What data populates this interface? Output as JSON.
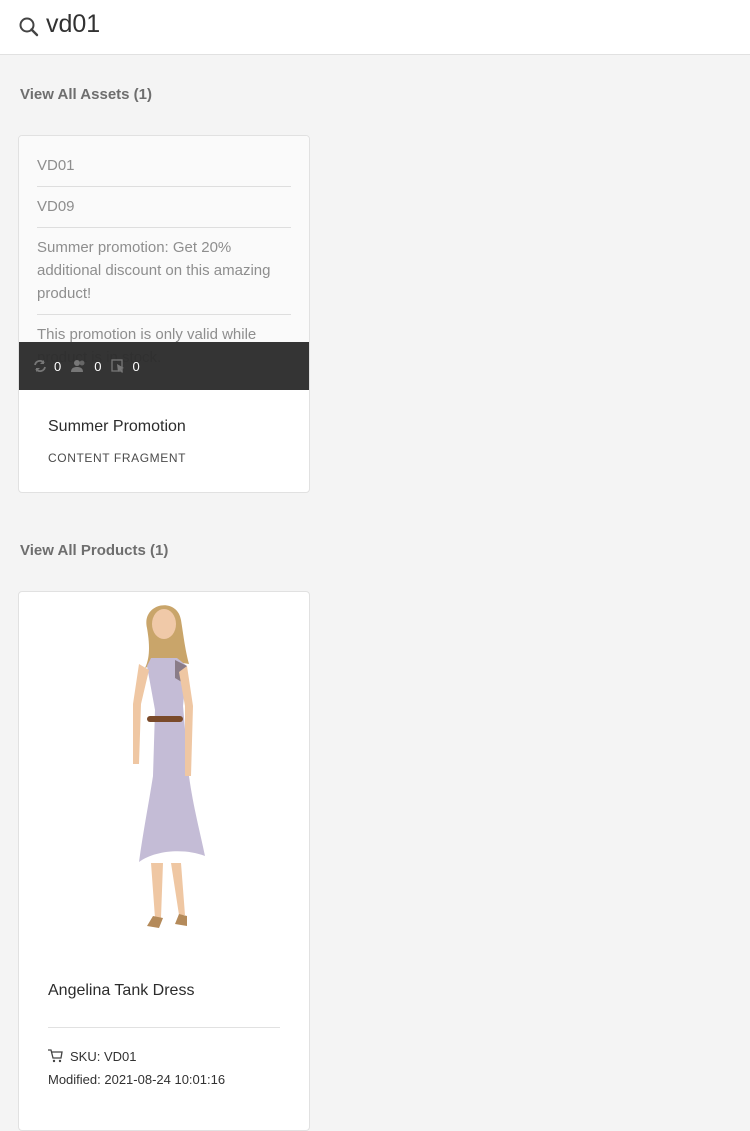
{
  "search": {
    "value": "vd01",
    "icon": "search-icon"
  },
  "assets": {
    "heading": "View All Assets (1)",
    "card": {
      "preview_rows": [
        "VD01",
        "VD09",
        "Summer promotion: Get 20% additional discount on this amazing product!",
        "This promotion is only valid while product is in stock."
      ],
      "stats": [
        {
          "icon": "sync-icon",
          "value": "0"
        },
        {
          "icon": "users-icon",
          "value": "0"
        },
        {
          "icon": "cursor-icon",
          "value": "0"
        }
      ],
      "title": "Summer Promotion",
      "type": "CONTENT FRAGMENT"
    }
  },
  "products": {
    "heading": "View All Products (1)",
    "card": {
      "title": "Angelina Tank Dress",
      "sku": "SKU: VD01",
      "modified": "Modified: 2021-08-24 10:01:16"
    }
  }
}
